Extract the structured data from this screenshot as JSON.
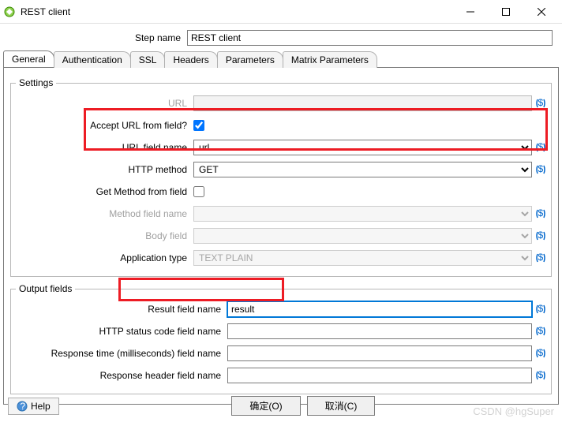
{
  "window": {
    "title": "REST client"
  },
  "step": {
    "label": "Step name",
    "value": "REST client"
  },
  "tabs": [
    "General",
    "Authentication",
    "SSL",
    "Headers",
    "Parameters",
    "Matrix Parameters"
  ],
  "settings": {
    "legend": "Settings",
    "url": {
      "label": "URL",
      "value": ""
    },
    "acceptUrl": {
      "label": "Accept URL from field?",
      "checked": true
    },
    "urlField": {
      "label": "URL field name",
      "value": "url"
    },
    "method": {
      "label": "HTTP method",
      "value": "GET"
    },
    "methodFromField": {
      "label": "Get Method from field",
      "checked": false
    },
    "methodField": {
      "label": "Method field name",
      "value": ""
    },
    "bodyField": {
      "label": "Body field",
      "value": ""
    },
    "appType": {
      "label": "Application type",
      "value": "TEXT PLAIN"
    }
  },
  "output": {
    "legend": "Output fields",
    "result": {
      "label": "Result field name",
      "value": "result"
    },
    "status": {
      "label": "HTTP status code field name",
      "value": ""
    },
    "respTime": {
      "label": "Response time (milliseconds) field name",
      "value": ""
    },
    "respHeader": {
      "label": "Response header field name",
      "value": ""
    }
  },
  "buttons": {
    "ok": "确定(O)",
    "cancel": "取消(C)",
    "help": "Help"
  },
  "watermark": "CSDN @hgSuper"
}
